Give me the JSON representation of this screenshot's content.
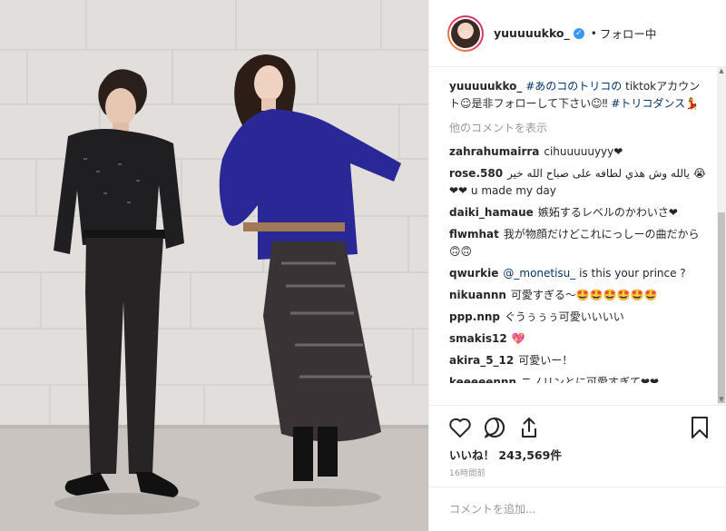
{
  "post": {
    "username": "yuuuuukko_",
    "verified_glyph": "✓",
    "separator": "•",
    "follow_status": "フォロー中"
  },
  "caption": {
    "username": "yuuuuukko_",
    "hashtag1": "#あのコのトリコの",
    "text1": " tiktokアカウント☺︎是非フォローして下さい☺︎‼︎ ",
    "hashtag2": "#トリコダンス",
    "emoji": "💃"
  },
  "view_more": "他のコメントを表示",
  "comments": [
    {
      "user": "zahrahumairra",
      "text": "cihuuuuuyyy❤"
    },
    {
      "user": "rose.580",
      "text": "يالله وش هذي لطافه على صباح الله خير 😭❤❤ u made my day"
    },
    {
      "user": "daiki_hamaue",
      "text": "嫉妬するレベルのかわいさ❤"
    },
    {
      "user": "flwmhat",
      "text": "我が物顔だけどこれにっしーの曲だから🙃🙃"
    },
    {
      "user": "qwurkie",
      "mention": "@_monetisu_",
      "text": " is this your prince ?"
    },
    {
      "user": "nikuannn",
      "text": "可愛すぎる〜🤩🤩🤩🤩🤩🤩"
    },
    {
      "user": "ppp.nnp",
      "text": "ぐうぅぅぅ可愛いいいい"
    },
    {
      "user": "smakis12",
      "text": "💖"
    },
    {
      "user": "akira_5_12",
      "text": "可愛いー！"
    },
    {
      "user": "keeeeennn",
      "text": "ニノリンとに可愛すぎて❤❤"
    }
  ],
  "likes": {
    "label": "いいね！",
    "count": "243,569",
    "suffix": "件"
  },
  "timestamp": "16時間前",
  "add_comment": {
    "placeholder": "コメントを追加..."
  },
  "icons": {
    "like": "heart-icon",
    "comment": "comment-bubble-icon",
    "share": "share-icon",
    "save": "bookmark-icon"
  },
  "colors": {
    "link": "#003569",
    "verified": "#3897f0",
    "muted": "#999999",
    "text": "#262626"
  }
}
